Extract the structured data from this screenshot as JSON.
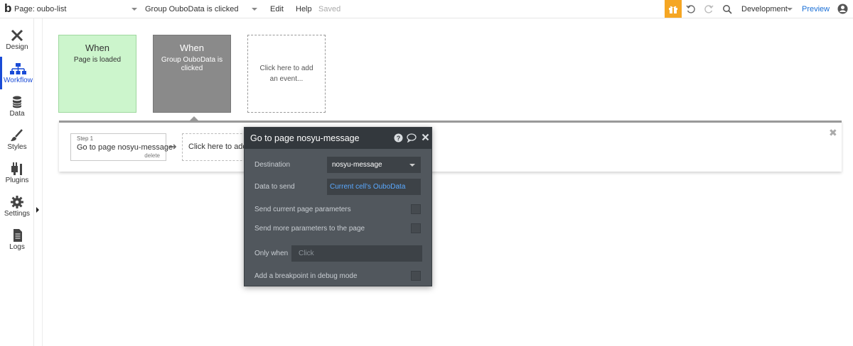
{
  "topbar": {
    "page_selector": "Page: oubo-list",
    "event_selector": "Group OuboData is clicked",
    "menu_edit": "Edit",
    "menu_help": "Help",
    "saved_status": "Saved",
    "environment": "Development",
    "preview": "Preview"
  },
  "sidebar": {
    "items": [
      {
        "label": "Design",
        "icon": "design-icon"
      },
      {
        "label": "Workflow",
        "icon": "workflow-icon"
      },
      {
        "label": "Data",
        "icon": "database-icon"
      },
      {
        "label": "Styles",
        "icon": "brush-icon"
      },
      {
        "label": "Plugins",
        "icon": "plug-icon"
      },
      {
        "label": "Settings",
        "icon": "gear-icon"
      },
      {
        "label": "Logs",
        "icon": "document-icon"
      }
    ]
  },
  "events": {
    "card1": {
      "when": "When",
      "text": "Page is loaded"
    },
    "card2": {
      "when": "When",
      "text": "Group OuboData is clicked"
    },
    "add_event": "Click here to add an event..."
  },
  "workflow": {
    "step_label": "Step 1",
    "step_title": "Go to page nosyu-message",
    "step_delete": "delete",
    "add_action": "Click here to add an action..."
  },
  "panel": {
    "title": "Go to page nosyu-message",
    "destination_label": "Destination",
    "destination_value": "nosyu-message",
    "data_label": "Data to send",
    "data_value": "Current cell's OuboData",
    "send_params_label": "Send current page parameters",
    "send_more_label": "Send more parameters to the page",
    "only_when_label": "Only when",
    "only_when_placeholder": "Click",
    "breakpoint_label": "Add a breakpoint in debug mode"
  },
  "colors": {
    "accent": "#1a4bd6",
    "gift": "#f5a623",
    "panel_bg": "#51575d",
    "link": "#5aa9ff"
  }
}
